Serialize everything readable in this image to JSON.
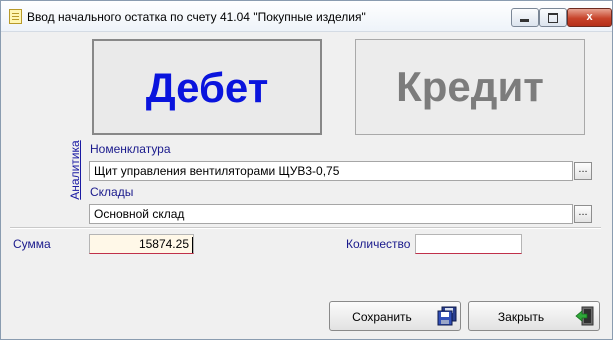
{
  "window": {
    "title": "Ввод начального остатка по счету 41.04 \"Покупные изделия\"",
    "buttons": {
      "minimize_icon": "minimize-icon",
      "maximize_icon": "maximize-icon",
      "close_glyph": "x"
    }
  },
  "toggle": {
    "debit_label": "Дебет",
    "credit_label": "Кредит",
    "selected": "debit"
  },
  "analytics": {
    "section_label": "Аналитика",
    "nomenclature_label": "Номенклатура",
    "nomenclature_value": "Щит управления вентиляторами ЩУВ3-0,75",
    "warehouses_label": "Склады",
    "warehouse_value": "Основной склад",
    "select_button_label": "..."
  },
  "amount": {
    "label": "Сумма",
    "value": "15874.25"
  },
  "quantity": {
    "label": "Количество",
    "value": ""
  },
  "actions": {
    "save_label": "Сохранить",
    "close_label": "Закрыть"
  },
  "colors": {
    "debit_text": "#0a14dd",
    "credit_text": "#7c7c7c",
    "label_text": "#1a1a8c",
    "field_underline": "#c0304a"
  }
}
